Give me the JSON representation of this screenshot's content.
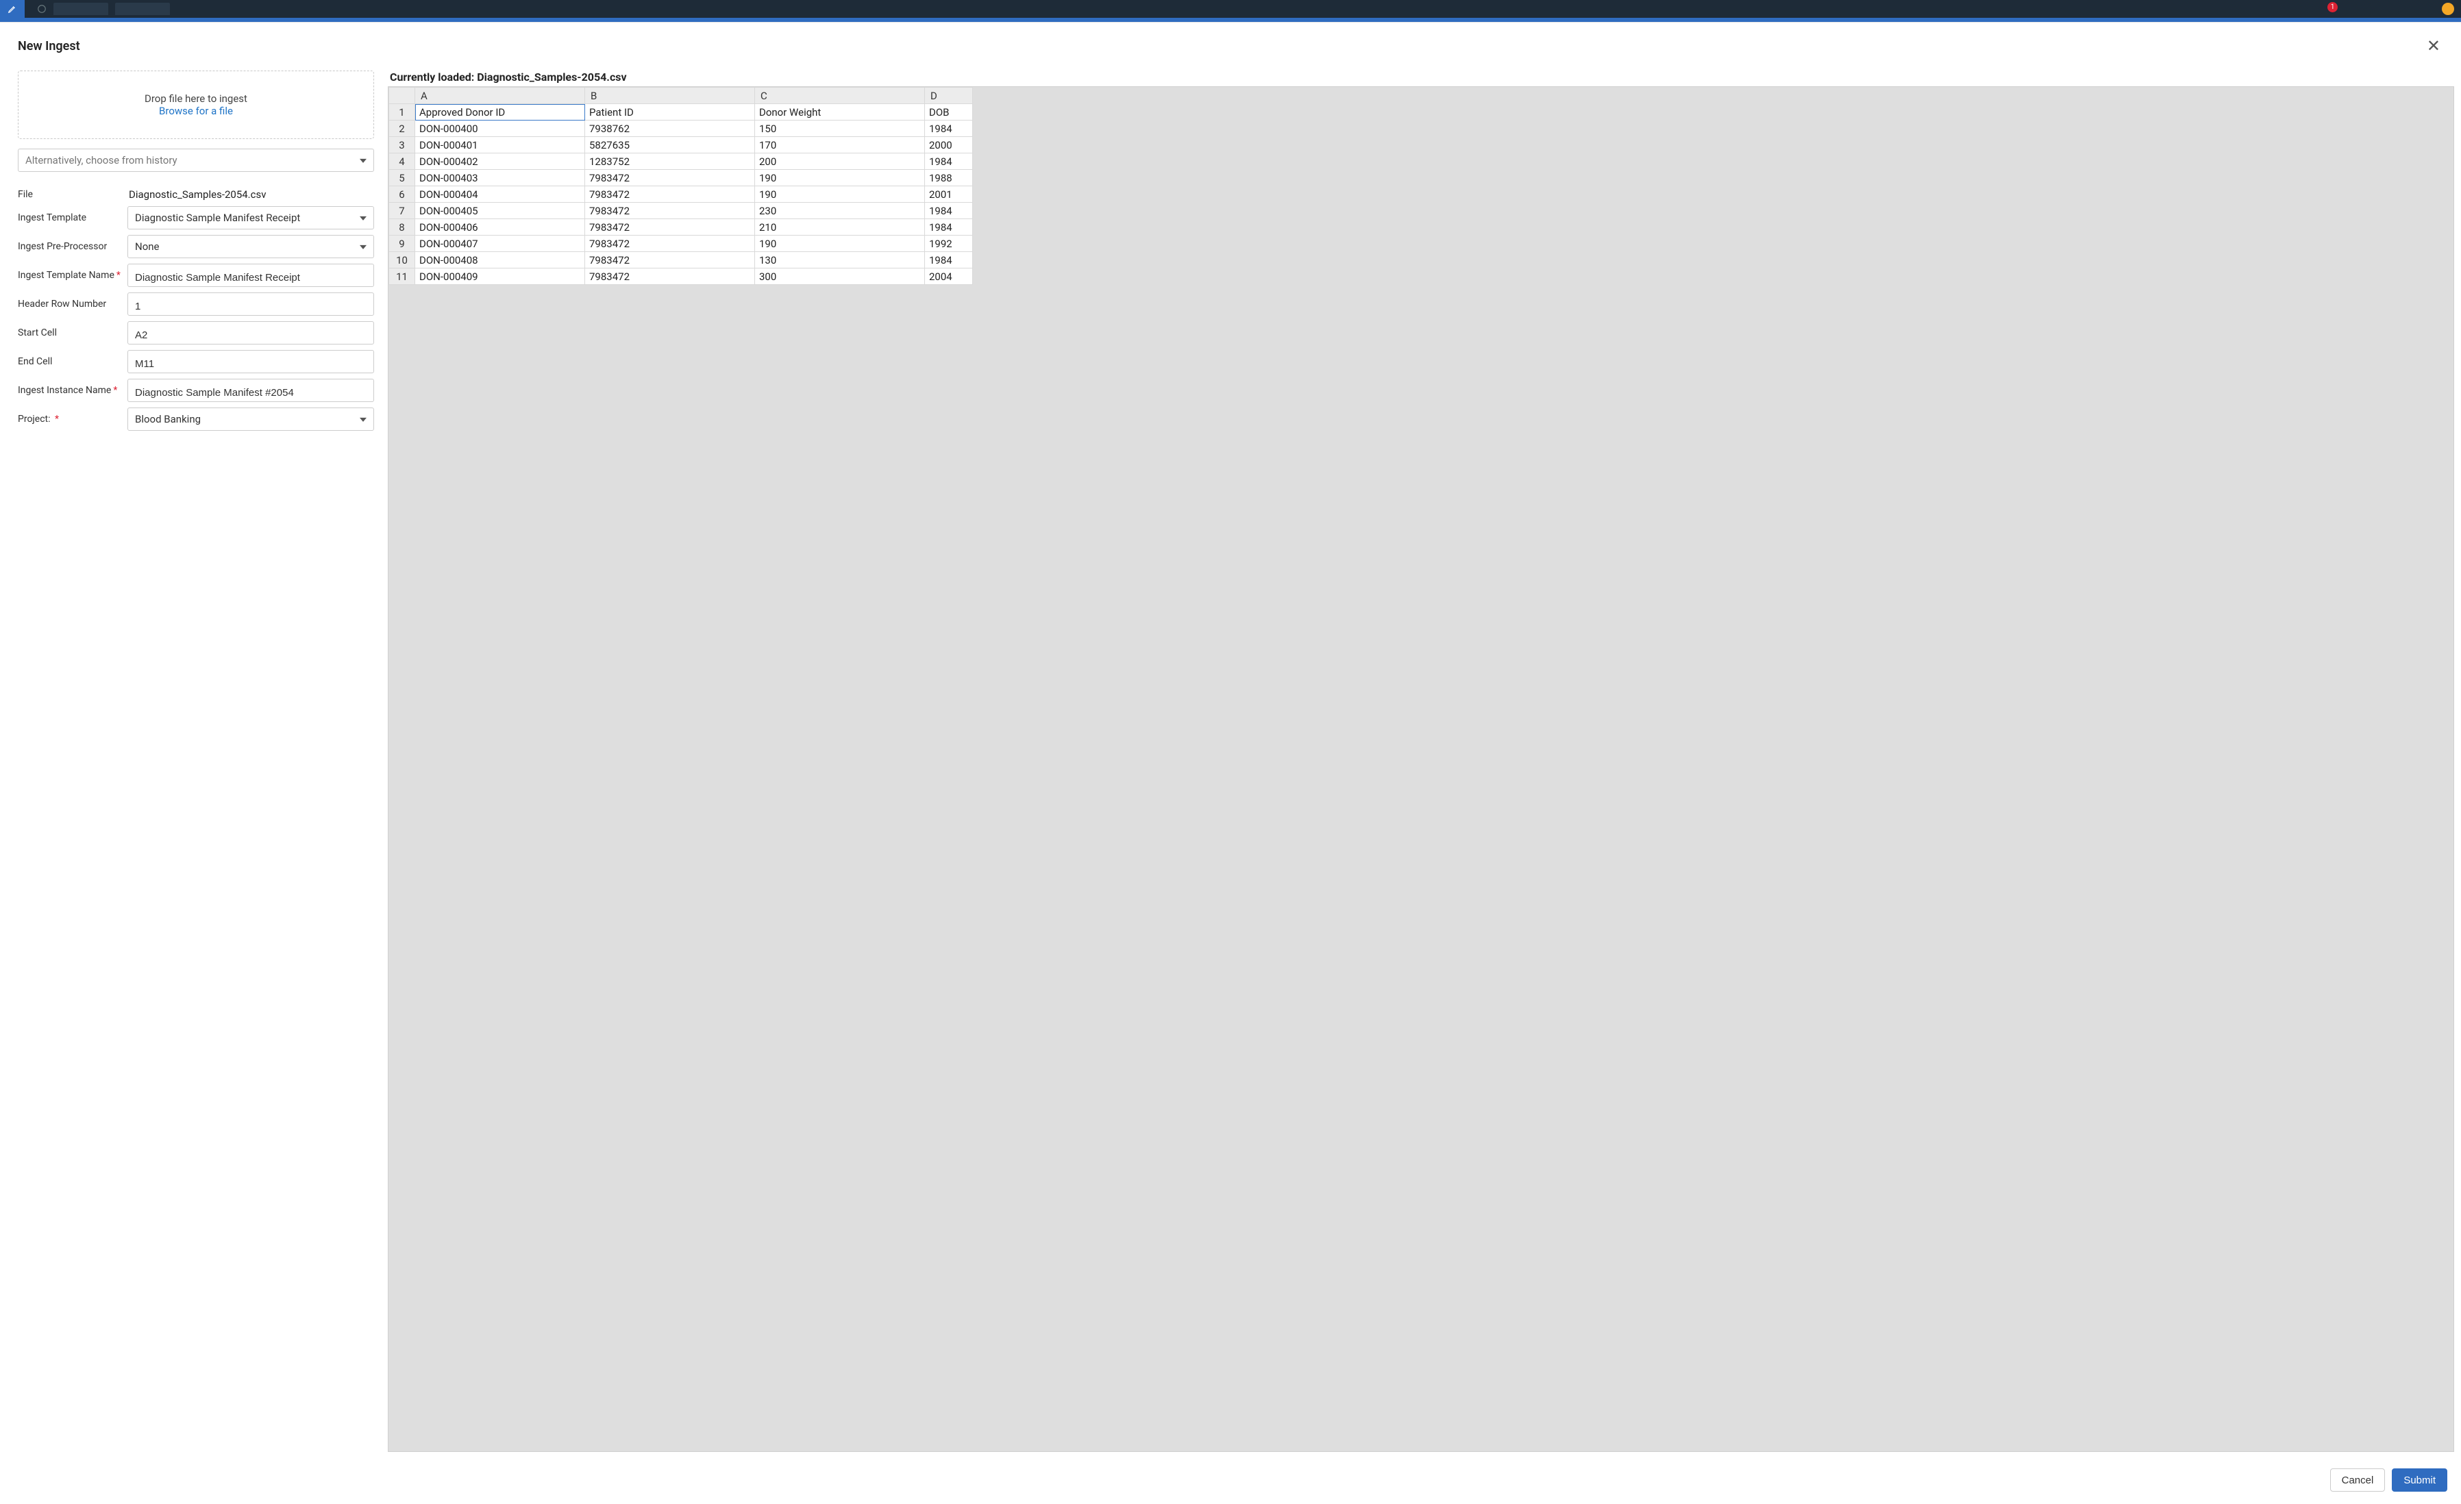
{
  "topbar": {
    "notification_count": "1"
  },
  "modal": {
    "title": "New Ingest",
    "dropzone_text": "Drop file here to ingest",
    "browse_text": "Browse for a file",
    "history_placeholder": "Alternatively, choose from history",
    "form": {
      "file_label": "File",
      "file_value": "Diagnostic_Samples-2054.csv",
      "template_label": "Ingest Template",
      "template_value": "Diagnostic Sample Manifest Receipt",
      "preproc_label": "Ingest Pre-Processor",
      "preproc_value": "None",
      "template_name_label": "Ingest Template Name",
      "template_name_value": "Diagnostic Sample Manifest Receipt",
      "header_row_label": "Header Row Number",
      "header_row_value": "1",
      "start_cell_label": "Start Cell",
      "start_cell_value": "A2",
      "end_cell_label": "End Cell",
      "end_cell_value": "M11",
      "instance_name_label": "Ingest Instance Name",
      "instance_name_value": "Diagnostic Sample Manifest #2054",
      "project_label": "Project:",
      "project_value": "Blood Banking"
    },
    "preview": {
      "label": "Currently loaded: Diagnostic_Samples-2054.csv",
      "columns": [
        "A",
        "B",
        "C",
        "D"
      ],
      "rows": [
        {
          "n": "1",
          "cells": [
            "Approved Donor ID",
            "Patient ID",
            "Donor Weight",
            "DOB"
          ]
        },
        {
          "n": "2",
          "cells": [
            "DON-000400",
            "7938762",
            "150",
            "1984"
          ]
        },
        {
          "n": "3",
          "cells": [
            "DON-000401",
            "5827635",
            "170",
            "2000"
          ]
        },
        {
          "n": "4",
          "cells": [
            "DON-000402",
            "1283752",
            "200",
            "1984"
          ]
        },
        {
          "n": "5",
          "cells": [
            "DON-000403",
            "7983472",
            "190",
            "1988"
          ]
        },
        {
          "n": "6",
          "cells": [
            "DON-000404",
            "7983472",
            "190",
            "2001"
          ]
        },
        {
          "n": "7",
          "cells": [
            "DON-000405",
            "7983472",
            "230",
            "1984"
          ]
        },
        {
          "n": "8",
          "cells": [
            "DON-000406",
            "7983472",
            "210",
            "1984"
          ]
        },
        {
          "n": "9",
          "cells": [
            "DON-000407",
            "7983472",
            "190",
            "1992"
          ]
        },
        {
          "n": "10",
          "cells": [
            "DON-000408",
            "7983472",
            "130",
            "1984"
          ]
        },
        {
          "n": "11",
          "cells": [
            "DON-000409",
            "7983472",
            "300",
            "2004"
          ]
        }
      ]
    },
    "footer": {
      "cancel": "Cancel",
      "submit": "Submit"
    }
  }
}
